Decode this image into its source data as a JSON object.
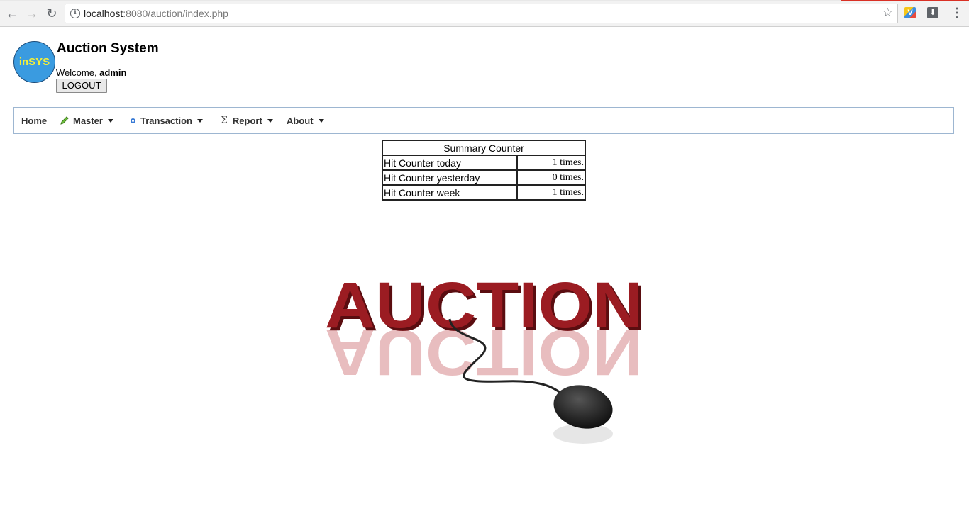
{
  "browser": {
    "url_host": "localhost",
    "url_rest": ":8080/auction/index.php"
  },
  "header": {
    "logo_text": "inSYS",
    "title": "Auction System",
    "welcome_prefix": "Welcome, ",
    "username": "admin",
    "logout_label": "LOGOUT"
  },
  "menu": {
    "items": [
      {
        "label": "Home"
      },
      {
        "label": "Master",
        "icon": "pencil-icon"
      },
      {
        "label": "Transaction",
        "icon": "gear-icon"
      },
      {
        "label": "Report",
        "icon": "sigma-icon"
      },
      {
        "label": "About"
      }
    ]
  },
  "summary": {
    "title": "Summary Counter",
    "rows": [
      {
        "label": "Hit Counter today",
        "value": "1 times."
      },
      {
        "label": "Hit Counter yesterday",
        "value": "0 times."
      },
      {
        "label": "Hit Counter week",
        "value": "1 times."
      }
    ]
  },
  "banner": {
    "word": "AUCTION",
    "color": "#9b1c22"
  }
}
